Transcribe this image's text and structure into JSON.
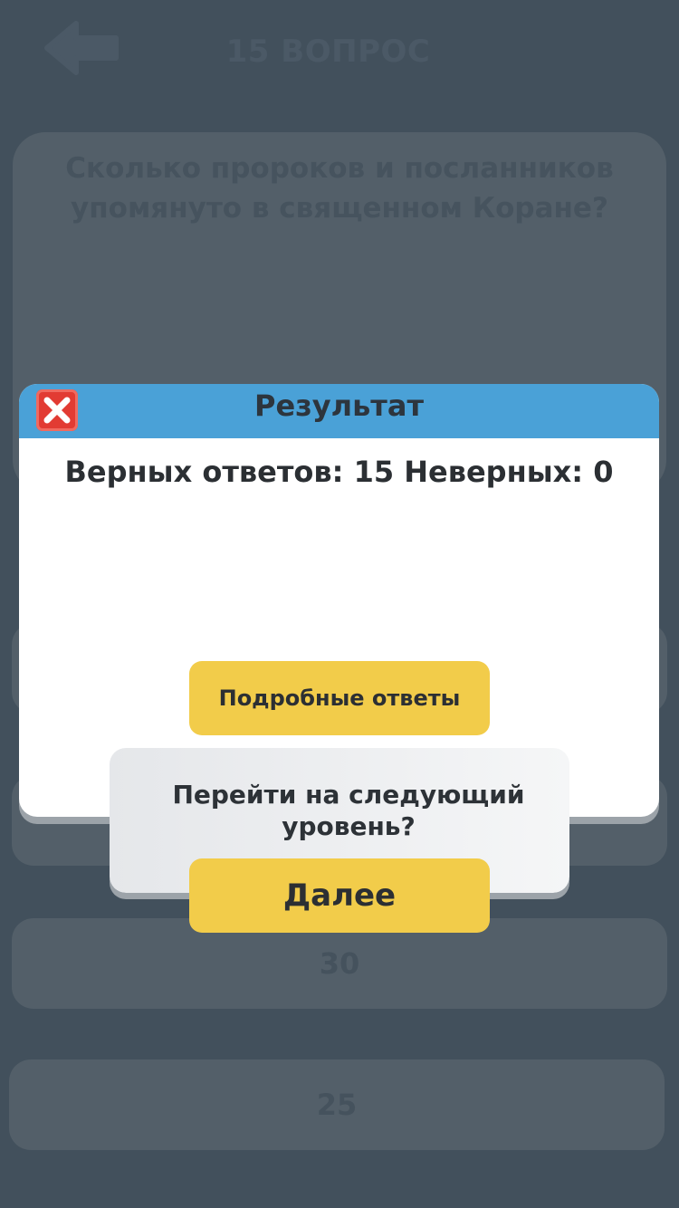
{
  "header": {
    "title": "15 ВОПРОС"
  },
  "question": {
    "text": "Сколько пророков и посланников упомянуто в священном Коране?"
  },
  "answers": [
    "",
    "",
    "30",
    "25"
  ],
  "result_dialog": {
    "title": "Результат",
    "score_line": "Верных ответов: 15 Неверных: 0",
    "details_button_label": "Подробные ответы"
  },
  "next_panel": {
    "prompt": "Перейти на следующий уровень?",
    "next_button_label": "Далее"
  },
  "colors": {
    "overlay_background": "#42505c",
    "dialog_header": "#4aa1d7",
    "button_yellow": "#f2cc4a",
    "close_red": "#e23b33"
  },
  "icons": {
    "back": "arrow-left-icon",
    "close": "close-icon"
  }
}
